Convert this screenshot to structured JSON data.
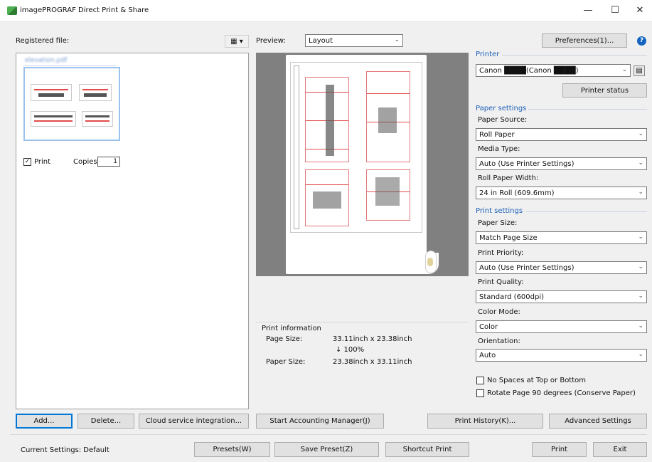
{
  "window": {
    "title": "imagePROGRAF Direct Print & Share",
    "minimize_glyph": "—",
    "maximize_glyph": "☐",
    "close_glyph": "✕"
  },
  "left": {
    "registered_label": "Registered file:",
    "view_toggle_glyph": "▦ ▾",
    "file_name": "elevation.pdf",
    "print_checkbox_label": "Print",
    "print_checked": true,
    "copies_label": "Copies",
    "copies_value": "1"
  },
  "preview": {
    "label": "Preview:",
    "mode_value": "Layout",
    "print_info_title": "Print information",
    "page_size_label": "Page Size:",
    "page_size_value": "33.11inch x 23.38inch",
    "scale_value": "↓  100%",
    "paper_size_label": "Paper Size:",
    "paper_size_value": "23.38inch x 33.11inch"
  },
  "right": {
    "preferences_label": "Preferences(1)...",
    "help_glyph": "?",
    "printer_group": "Printer",
    "printer_value": "Canon ████(Canon ████)",
    "printer_status_label": "Printer status",
    "paper_settings_group": "Paper settings",
    "paper_source_label": "Paper Source:",
    "paper_source_value": "Roll Paper",
    "media_type_label": "Media Type:",
    "media_type_value": "Auto (Use Printer Settings)",
    "roll_width_label": "Roll Paper Width:",
    "roll_width_value": "24 in Roll (609.6mm)",
    "print_settings_group": "Print settings",
    "paper_size_label": "Paper Size:",
    "paper_size_value": "Match Page Size",
    "print_priority_label": "Print Priority:",
    "print_priority_value": "Auto (Use Printer Settings)",
    "print_quality_label": "Print Quality:",
    "print_quality_value": "Standard (600dpi)",
    "color_mode_label": "Color Mode:",
    "color_mode_value": "Color",
    "orientation_label": "Orientation:",
    "orientation_value": "Auto",
    "no_spaces_label": "No Spaces at Top or Bottom",
    "rotate_label": "Rotate Page 90 degrees (Conserve Paper)"
  },
  "buttons": {
    "add": "Add...",
    "delete": "Delete...",
    "cloud": "Cloud service integration...",
    "accounting": "Start Accounting Manager(J)",
    "print_history": "Print History(K)...",
    "advanced": "Advanced Settings",
    "presets": "Presets(W)",
    "save_preset": "Save Preset(Z)",
    "shortcut": "Shortcut Print",
    "print": "Print",
    "exit": "Exit"
  },
  "status": {
    "current_settings": "Current Settings: Default"
  }
}
